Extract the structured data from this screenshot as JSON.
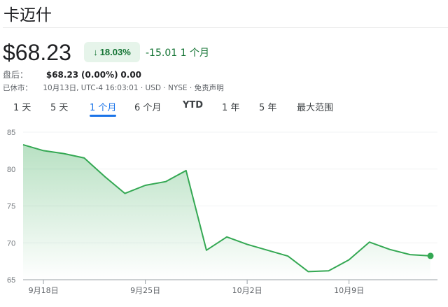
{
  "header": {
    "title": "卡迈什"
  },
  "quote": {
    "price": "$68.23",
    "change_pct": "18.03%",
    "change_arrow": "↓",
    "change_abs": "-15.01",
    "change_period": "1 个月"
  },
  "after_hours": {
    "label": "盘后：",
    "price": "$68.23",
    "pct": "(0.00%)",
    "abs": "0.00"
  },
  "status": {
    "label": "已休市：",
    "details": "10月13日, UTC-4 16:03:01 · USD · NYSE · 免责声明"
  },
  "tabs": [
    {
      "label": "1 天"
    },
    {
      "label": "5 天"
    },
    {
      "label": "1 个月",
      "active": true
    },
    {
      "label": "6 个月"
    },
    {
      "label": "YTD"
    },
    {
      "label": "1 年"
    },
    {
      "label": "5 年"
    },
    {
      "label": "最大范围"
    }
  ],
  "colors": {
    "line": "#34a853",
    "text_green": "#137333",
    "accent": "#1a73e8"
  },
  "chart_data": {
    "type": "line",
    "title": "",
    "xlabel": "",
    "ylabel": "",
    "ylim": [
      65,
      85
    ],
    "yticks": [
      65,
      70,
      75,
      80,
      85
    ],
    "grid": true,
    "values": [
      83.3,
      82.5,
      82.1,
      81.5,
      79.0,
      76.7,
      77.8,
      78.3,
      79.8,
      69.0,
      70.8,
      69.8,
      69.0,
      68.2,
      66.1,
      66.2,
      67.7,
      70.1,
      69.1,
      68.4,
      68.23
    ],
    "xticks": [
      {
        "index": 1,
        "label": "9月18日"
      },
      {
        "index": 6,
        "label": "9月25日"
      },
      {
        "index": 11,
        "label": "10月2日"
      },
      {
        "index": 16,
        "label": "10月9日"
      }
    ]
  }
}
